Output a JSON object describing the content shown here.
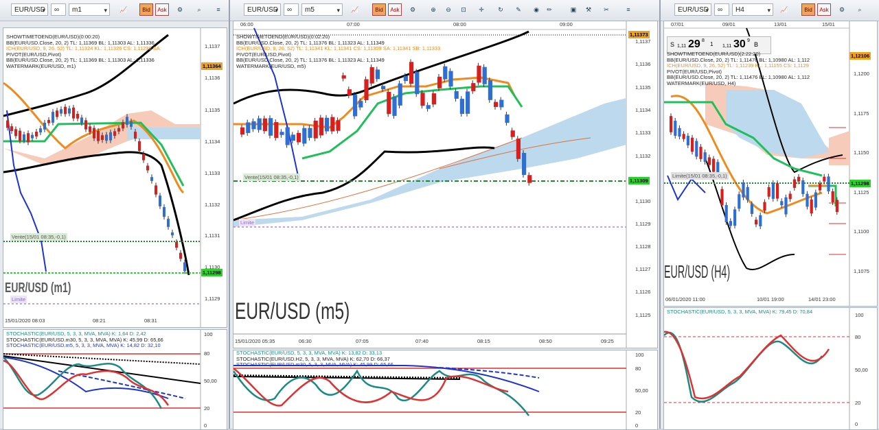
{
  "panels": [
    {
      "symbol": "EUR/USD",
      "timeframe": "m1",
      "legend": [
        "SHOWTIMETOEND(EUR/USD)(0:00:20)",
        "BB(EUR/USD.Close, 20, 2)  TL: 1,11369  BL: 1,11303  AL: 1,11336",
        "ICH(EUR/USD, 9, 26, 52)  TL: 1,11324  KL: 1,11326  CS: 1,11298  SA:",
        "PIVOT(EUR/USD,Pivot)",
        "BB(EUR/USD.Close, 20, 2)  TL: 1,11369  BL: 1,11303  AL: 1,11336",
        "WATERMARK(EUR/USD, m1)"
      ],
      "yticks": [
        "1,1137",
        "1,1136",
        "1,1135",
        "1,1134",
        "1,1133",
        "1,1132",
        "1,1131",
        "1,1130",
        "1,1129"
      ],
      "price_top": "1,11364",
      "price_bottom": "1,11298",
      "xticks": [
        "15/01/2020 08:03",
        "08:21",
        "08:31"
      ],
      "order_label": "Vente(15/01 08:35,-0,1)",
      "limit_label": "Limite",
      "watermark": "EUR/USD (m1)",
      "stoch_legend": [
        "STOCHASTIC(EUR/USD, 5, 3, 3, MVA, MVA)  K: 1,64  D: 2,42",
        "STOCHASTIC(EUR/USD.m30, 5, 3, 3, MVA, MVA)  K: 45,99  D: 65,66",
        "STOCHASTIC(EUR/USD.m5, 5, 3, 3, MVA, MVA)  K: 14,82  D: 32,10"
      ],
      "stoch_ticks": [
        "100",
        "80",
        "50,00",
        "20",
        "0"
      ]
    },
    {
      "symbol": "EUR/USD",
      "timeframe": "m5",
      "legend": [
        "SHOWTIMETOEND(EUR/USD)(0:02:20)",
        "BB(EUR/USD.Close, 20, 2)  TL: 1,11376  BL: 1,11323  AL: 1,11349",
        "ICH(EUR/USD, 9, 26, 52)  TL: 1,11341  KL: 1,11341  CS: 1,11309  SA: 1,11341  SB: 1,11333",
        "PIVOT(EUR/USD,Pivot)",
        "BB(EUR/USD.Close, 20, 2)  TL: 1,11376  BL: 1,11323  AL: 1,11349",
        "WATERMARK(EUR/USD, m5)"
      ],
      "topticks": [
        "06:00",
        "07:00",
        "08:00",
        "09:00"
      ],
      "yticks": [
        "1,1137",
        "1,1136",
        "1,1135",
        "1,1134",
        "1,1133",
        "1,1132",
        "1,1131",
        "1,1130",
        "1,1129",
        "1,1128",
        "1,1127",
        "1,1126",
        "1,1125"
      ],
      "price_top": "1,11373",
      "price_bottom": "1,11309",
      "xticks": [
        "15/01/2020 05:35",
        "06:30",
        "07:05",
        "07:40",
        "08:15",
        "08:50",
        "09:25"
      ],
      "order_label": "Vente(15/01 08:35,-0,1)",
      "limit_label": "Limite",
      "watermark": "EUR/USD (m5)",
      "stoch_legend": [
        "STOCHASTIC(EUR/USD, 5, 3, 3, MVA, MVA)  K: 13,82  D: 33,13",
        "STOCHASTIC(EUR/USD.H2, 5, 3, 3, MVA, MVA)  K: 62,70  D: 66,37",
        "STOCHASTIC(EUR/USD.m30, 5, 3, 3, MVA, MVA)  K: 45,99  D: 65,66"
      ],
      "stoch_ticks": [
        "100",
        "80",
        "50,00",
        "20",
        "0"
      ]
    },
    {
      "symbol": "EUR/USD",
      "timeframe": "H4",
      "legend": [
        "SHOWTIMETOEND(EUR/USD)(2:22:20)",
        "BB(EUR/USD.Close, 20, 2)  TL: 1,11476  BL: 1,10980  AL: 1,112",
        "ICH(EUR/USD, 9, 26, 52)  TL: 1,11239  KL: 1,11155  CS: 1,1129",
        "PIVOT(EUR/USD,Pivot)",
        "BB(EUR/USD.Close, 20, 2)  TL: 1,11476  BL: 1,10980  AL: 1,112",
        "WATERMARK(EUR/USD, H4)"
      ],
      "topticks": [
        "07/01",
        "09/01",
        "13/01",
        "15/01"
      ],
      "quote": {
        "s_label": "S",
        "s_prefix": "1,11",
        "s_big": "29",
        "s_sup": "8",
        "spread": "1",
        "b_prefix": "1,11",
        "b_big": "30",
        "b_sup": "9",
        "b_label": "B"
      },
      "yticks": [
        "1,1200",
        "1,1175",
        "1,1150",
        "1,1125",
        "1,1100",
        "1,1075"
      ],
      "price_top": "1,12106",
      "price_bottom": "1,11298",
      "xticks": [
        "06/01/2020 11:00",
        "10/01 19:00",
        "14/01 23:00"
      ],
      "order_label": "Limite(15/01 08:35,-0,1)",
      "watermark": "EUR/USD (H4)",
      "stoch_legend": [
        "STOCHASTIC(EUR/USD, 5, 3, 3, MVA, MVA)  K: 79,45  D: 70,84"
      ],
      "stoch_ticks": [
        "100",
        "80",
        "50,00",
        "20",
        "0"
      ]
    }
  ],
  "bid_label": "Bid",
  "ask_label": "Ask",
  "colors": {
    "bull": "#2f6fd0",
    "bear": "#d61f1f",
    "bb": "#000000",
    "ich_tenkan": "#f08a1c",
    "ich_kijun": "#1fbf5a",
    "cloud_up": "#bcd9ee",
    "cloud_down": "#f6cbb9",
    "order": "#1a8a2a",
    "limit": "#a98ad6"
  }
}
